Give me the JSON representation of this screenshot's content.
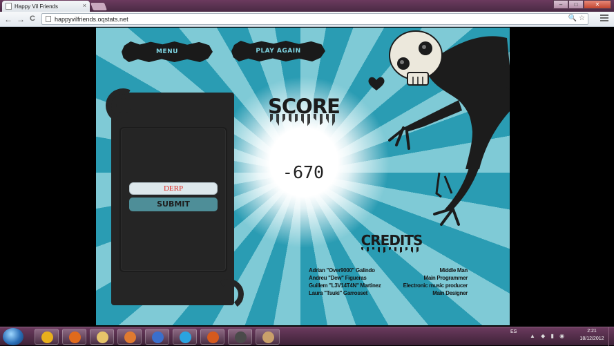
{
  "browser": {
    "tab_title": "Happy Vil Friends",
    "tab_close": "×",
    "url": "happyvilfriends.oqstats.net",
    "nav_back": "←",
    "nav_forward": "→",
    "nav_reload": "C",
    "omnibox_icons": "🔍 ☆",
    "win_minimize": "–",
    "win_maximize": "□",
    "win_close": "✕"
  },
  "game": {
    "menu_label": "MENU",
    "play_again_label": "PLAY AGAIN",
    "name_value": "DERP",
    "submit_label": "SUBMIT",
    "score_title": "SCORE",
    "score_value": "-670",
    "credits_title": "CREDITS",
    "credits": [
      {
        "name": "Adrian \"Over9000\" Galindo",
        "role": "Middle Man"
      },
      {
        "name": "Andreu \"Dew\" Figueras",
        "role": "Main Programmer"
      },
      {
        "name": "Guillem \"L3V14T4N\" Martinez",
        "role": "Electronic music producer"
      },
      {
        "name": "Laura \"Tsuki\" Garrosset",
        "role": "Main Designer"
      }
    ]
  },
  "taskbar": {
    "apps": [
      {
        "icon": "chrome-icon",
        "color": "#e8b01c"
      },
      {
        "icon": "firefox-icon",
        "color": "#e06a1c"
      },
      {
        "icon": "explorer-icon",
        "color": "#e6c46a"
      },
      {
        "icon": "media-player-icon",
        "color": "#e07a30"
      },
      {
        "icon": "messenger-icon",
        "color": "#3a6fcc"
      },
      {
        "icon": "skype-icon",
        "color": "#2aa3e0"
      },
      {
        "icon": "game-icon",
        "color": "#d55a1e"
      },
      {
        "icon": "steam-icon",
        "color": "#4a4a4a"
      },
      {
        "icon": "paint-icon",
        "color": "#c9a06a"
      }
    ],
    "language": "ES",
    "time": "2:21",
    "date": "18/12/2012"
  }
}
